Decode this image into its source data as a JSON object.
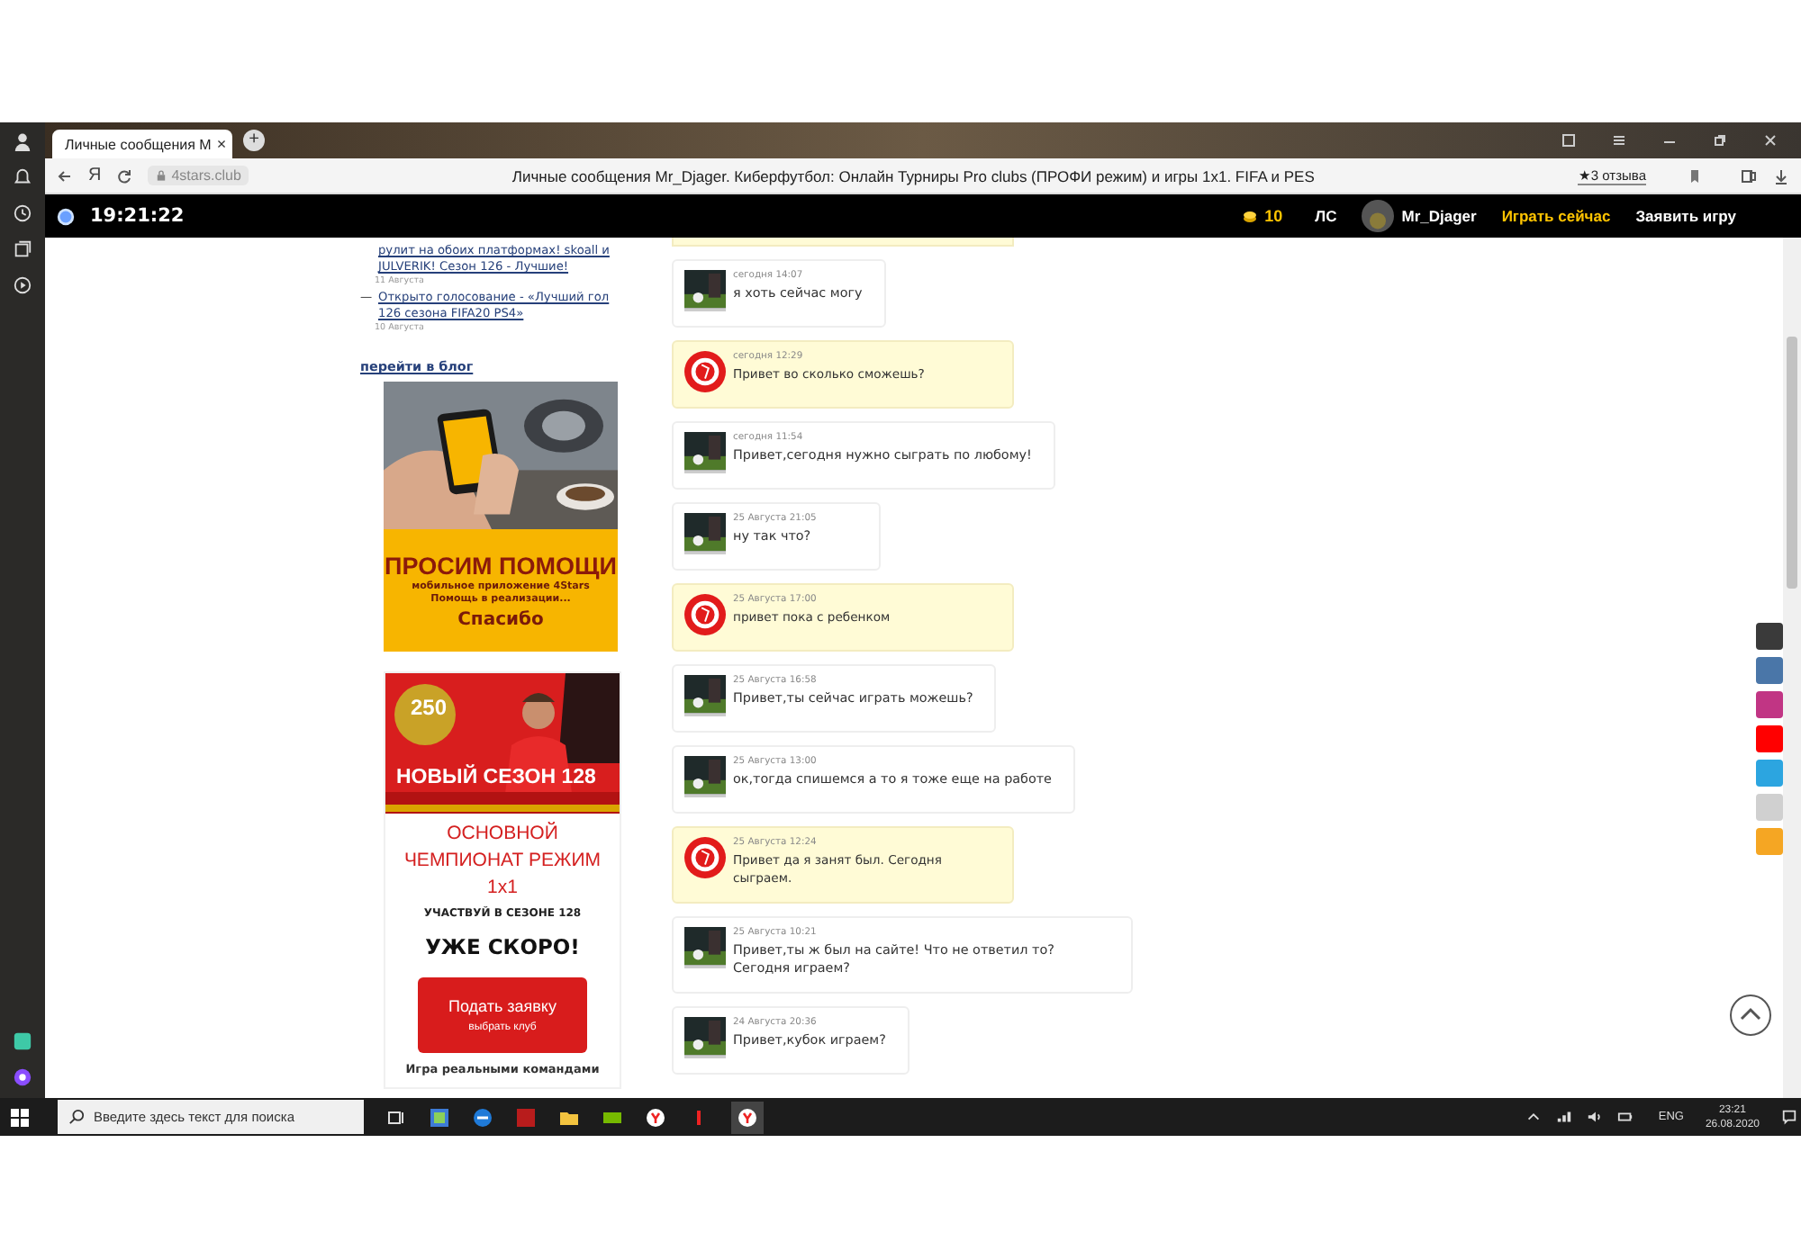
{
  "browser": {
    "tab": {
      "title": "Личные сообщения M",
      "close": "×"
    },
    "new_tab": "+",
    "address": "4stars.club",
    "page_title": "Личные сообщения Mr_Djager. Киберфутбол: Онлайн Турниры Pro clubs (ПРОФИ режим) и игры 1x1. FIFA и PES",
    "reviews": "★3 отзыва",
    "yandex": "Я"
  },
  "site_header": {
    "time": "19:21:22",
    "coins": "10",
    "messages_link": "ЛС",
    "username": "Mr_Djager",
    "play_now": "Играть сейчас",
    "declare_game": "Заявить игру"
  },
  "blog": {
    "posts": [
      {
        "title": "рулит на обоих платформах! skoall и JULVERIK! Сезон 126 - Лучшие!",
        "date": "11 Августа"
      },
      {
        "title": "Открыто голосование - «Лучший гол 126 сезона FIFA20 PS4»",
        "date": "10 Августа",
        "bullet": "—"
      }
    ],
    "more_link": "перейти в блог"
  },
  "ad_help": {
    "title": "ПРОСИМ ПОМОЩИ",
    "line_1": "мобильное приложение 4Stars",
    "line_2": "Помощь в реализации...",
    "thanks": "Спасибо"
  },
  "ad_season": {
    "badge": "250",
    "banner_title": "НОВЫЙ СЕЗОН 128",
    "heading": "ОСНОВНОЙ ЧЕМПИОНАТ РЕЖИМ 1x1",
    "subheading": "УЧАСТВУЙ В СЕЗОНЕ 128",
    "soon": "УЖЕ СКОРО!",
    "button": {
      "label": "Подать заявку",
      "sublabel": "выбрать клуб"
    },
    "footer": "Игра реальными командами"
  },
  "messages": [
    {
      "kind": "mine",
      "date": "сегодня 14:07",
      "text": "я хоть сейчас могу"
    },
    {
      "kind": "theirs",
      "date": "сегодня 12:29",
      "text": "Привет во сколько сможешь?"
    },
    {
      "kind": "mine",
      "date": "сегодня 11:54",
      "text": "Привет,сегодня нужно сыграть по любому!"
    },
    {
      "kind": "mine",
      "date": "25 Августа 21:05",
      "text": "ну так что?"
    },
    {
      "kind": "theirs",
      "date": "25 Августа 17:00",
      "text": "привет пока с ребенком"
    },
    {
      "kind": "mine",
      "date": "25 Августа 16:58",
      "text": "Привет,ты сейчас играть можешь?"
    },
    {
      "kind": "mine",
      "date": "25 Августа 13:00",
      "text": "ок,тогда спишемся а то я тоже еще на работе"
    },
    {
      "kind": "theirs",
      "date": "25 Августа 12:24",
      "text": "Привет да я занят был. Сегодня сыграем."
    },
    {
      "kind": "mine",
      "date": "25 Августа 10:21",
      "text": "Привет,ты ж был на сайте! Что не ответил то? Сегодня играем?"
    },
    {
      "kind": "mine",
      "date": "24 Августа 20:36",
      "text": "Привет,кубок играем?"
    }
  ],
  "social": [
    {
      "color": "#3a3a3a"
    },
    {
      "color": "#4a76a8"
    },
    {
      "color": "#c13584"
    },
    {
      "color": "#ff0000"
    },
    {
      "color": "#2ca5e0"
    },
    {
      "color": "#d0d0d0"
    },
    {
      "color": "#f5a623"
    }
  ],
  "taskbar": {
    "search_placeholder": "Введите здесь текст для поиска",
    "language": "ENG",
    "time": "23:21",
    "date": "26.08.2020"
  }
}
